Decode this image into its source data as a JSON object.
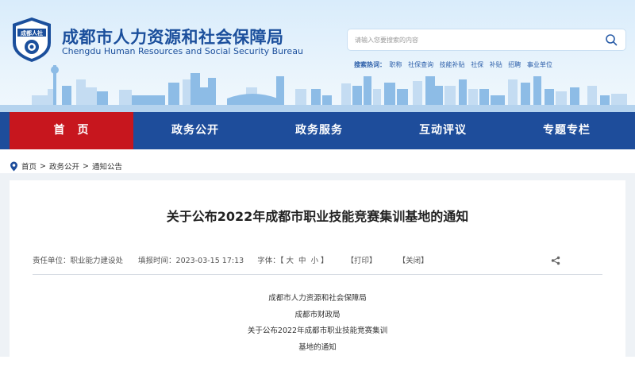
{
  "header": {
    "logo_text": "成都人社",
    "title_cn": "成都市人力资源和社会保障局",
    "title_en": "Chengdu Human Resources and Social Security Bureau"
  },
  "search": {
    "placeholder": "请输入您要搜索的内容",
    "hot_label": "搜索热词：",
    "hot_words": [
      "职称",
      "社保查询",
      "技能补贴",
      "社保",
      "补贴",
      "招聘",
      "事业单位"
    ]
  },
  "nav": {
    "items": [
      "首　页",
      "政务公开",
      "政务服务",
      "互动评议",
      "专题专栏"
    ]
  },
  "breadcrumb": {
    "items": [
      "首页",
      "政务公开",
      "通知公告"
    ],
    "separator": ">"
  },
  "article": {
    "title": "关于公布2022年成都市职业技能竞赛集训基地的通知",
    "meta": {
      "unit": "责任单位：职业能力建设处",
      "date": "填报时间：2023-03-15 17:13",
      "font_label": "字体：【",
      "font_l": "大",
      "font_m": "中",
      "font_s": "小",
      "font_end": "】",
      "print": "【打印】",
      "close": "【关闭】"
    },
    "lines": [
      "成都市人力资源和社会保障局",
      "成都市财政局",
      "关于公布2022年成都市职业技能竞赛集训",
      "基地的通知"
    ]
  },
  "colors": {
    "nav_bg": "#1e4d9b",
    "nav_active": "#c7161e",
    "title_blue": "#1b4f9c"
  }
}
